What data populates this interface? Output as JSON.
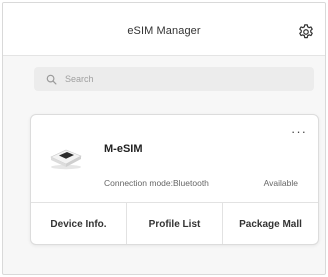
{
  "header": {
    "title": "eSIM Manager",
    "settings_icon": "gear-icon"
  },
  "search": {
    "placeholder": "Search",
    "icon": "search-icon"
  },
  "device": {
    "name": "M-eSIM",
    "connection_mode": "Connection mode:Bluetooth",
    "status": "Available",
    "more_label": "···",
    "image_icon": "device-icon"
  },
  "actions": [
    {
      "label": "Device Info."
    },
    {
      "label": "Profile List"
    },
    {
      "label": "Package Mall"
    }
  ],
  "colors": {
    "background": "#f7f7f7",
    "card": "#ffffff",
    "search_bg": "#ececec",
    "text": "#333333"
  }
}
